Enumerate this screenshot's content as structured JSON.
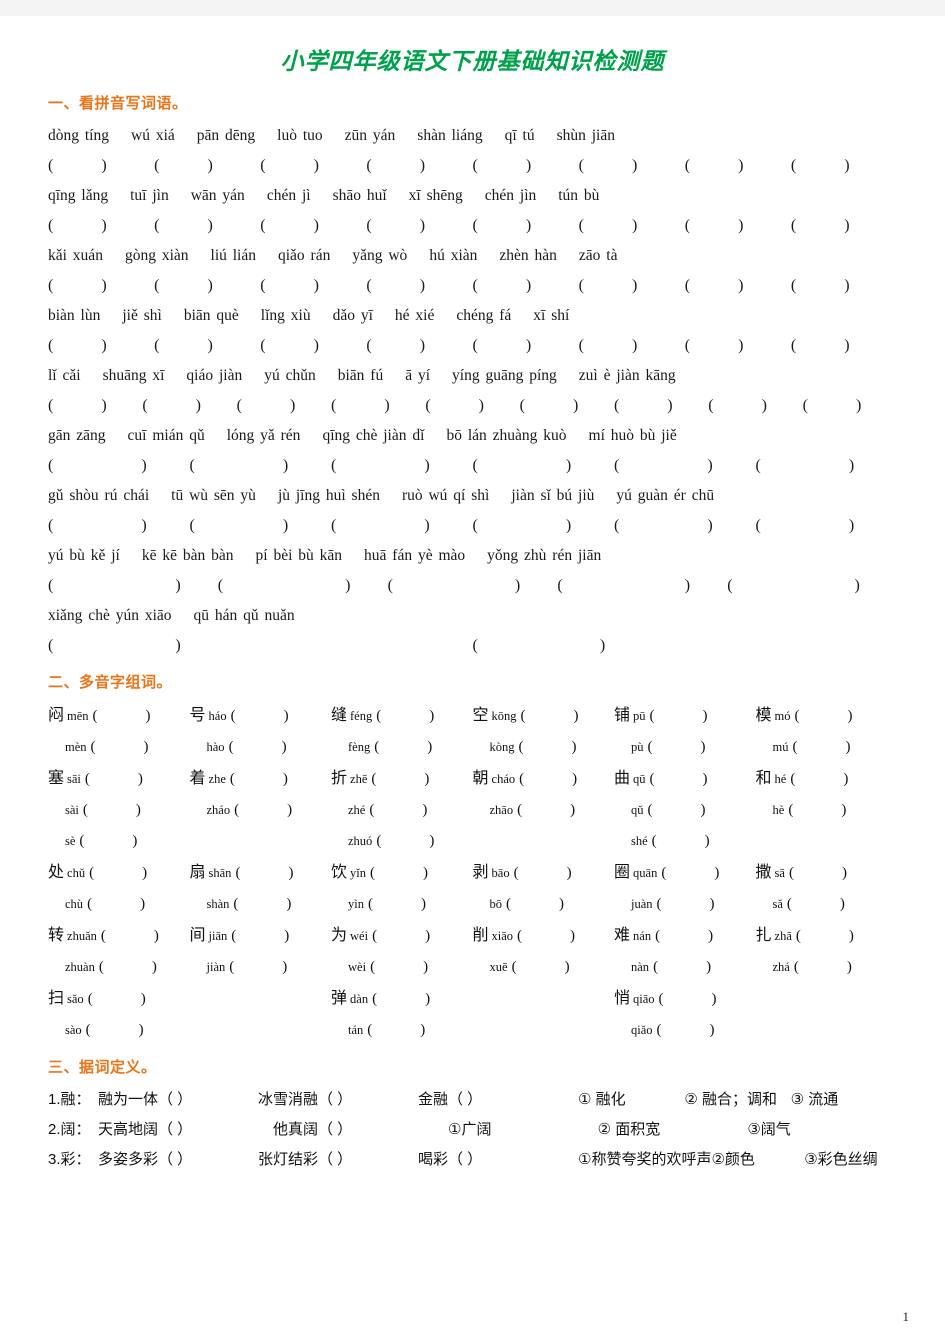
{
  "document": {
    "title": "小学四年级语文下册基础知识检测题",
    "page_number": "1",
    "title_color": "#00A14B",
    "heading_color": "#E8751A"
  },
  "section1": {
    "heading": "一、看拼音写词语。",
    "blocks": [
      {
        "words": [
          "dòng tíng",
          "wú xiá",
          "pān dēng",
          "luò tuo",
          "zūn yán",
          "shàn liáng",
          "qī tú",
          "shùn jiān"
        ],
        "blank_count": 8
      },
      {
        "words": [
          "qīng lǎng",
          "tuī jìn",
          "wān yán",
          "chén jì",
          "shāo huǐ",
          "xī shēng",
          "chén jìn",
          "tún bù"
        ],
        "blank_count": 8
      },
      {
        "words": [
          "kǎi xuán",
          "gòng xiàn",
          "liú lián",
          "qiǎo rán",
          "yǎng wò",
          "hú xiàn",
          "zhèn hàn",
          "zāo tà"
        ],
        "blank_count": 8
      },
      {
        "words": [
          "biàn lùn",
          "jiě shì",
          "biān què",
          "lǐng xiù",
          "dǎo yī",
          "hé xié",
          "chéng fá",
          "xī shí"
        ],
        "blank_count": 8
      },
      {
        "words": [
          "lǐ cǎi",
          "shuāng xī",
          "qiáo jiàn",
          "yú chǔn",
          "biān fú",
          "ā yí",
          "yíng guāng píng",
          "zuì è jiàn kāng"
        ],
        "blank_count": 9
      },
      {
        "words": [
          "gān zāng",
          "cuī mián qǔ",
          "lóng yǎ rén",
          "qīng chè jiàn dǐ",
          "bō lán zhuàng kuò",
          "mí huò bù jiě"
        ],
        "blank_count": 6
      },
      {
        "words": [
          "gǔ shòu rú chái",
          "tū wù sēn yù",
          "jù jīng huì shén",
          "ruò wú qí shì",
          "jiàn sǐ bú jiù",
          "yú guàn ér chū"
        ],
        "blank_count": 6
      },
      {
        "words": [
          "yú bù kě jí",
          "kē kē bàn bàn",
          "pí bèi bù kān",
          "huā fán yè mào",
          "yǒng zhù rén jiān"
        ],
        "blank_count": 5
      },
      {
        "words": [
          "xiǎng chè yún xiāo",
          "qū hán qǔ nuǎn"
        ],
        "blank_count": 2
      }
    ]
  },
  "section2": {
    "heading": "二、多音字组词。",
    "groups": [
      {
        "rows": [
          [
            {
              "han": "闷",
              "py": "mēn"
            },
            {
              "han": "号",
              "py": "háo"
            },
            {
              "han": "缝",
              "py": "féng"
            },
            {
              "han": "空",
              "py": "kōng"
            },
            {
              "han": "铺",
              "py": "pū"
            },
            {
              "han": "模",
              "py": "mó"
            }
          ],
          [
            {
              "han": "",
              "py": "mèn"
            },
            {
              "han": "",
              "py": "hào"
            },
            {
              "han": "",
              "py": "fèng"
            },
            {
              "han": "",
              "py": "kòng"
            },
            {
              "han": "",
              "py": "pù"
            },
            {
              "han": "",
              "py": "mú"
            }
          ]
        ]
      },
      {
        "rows": [
          [
            {
              "han": "塞",
              "py": "sāi"
            },
            {
              "han": "着",
              "py": "zhe"
            },
            {
              "han": "折",
              "py": "zhē"
            },
            {
              "han": "朝",
              "py": "cháo"
            },
            {
              "han": "曲",
              "py": "qū"
            },
            {
              "han": "和",
              "py": "hé"
            }
          ],
          [
            {
              "han": "",
              "py": "sài"
            },
            {
              "han": "",
              "py": "zháo"
            },
            {
              "han": "",
              "py": "zhé"
            },
            {
              "han": "",
              "py": "zhāo"
            },
            {
              "han": "",
              "py": "qǔ"
            },
            {
              "han": "",
              "py": "hè"
            }
          ],
          [
            {
              "han": "",
              "py": "sè"
            },
            {
              "han": "",
              "py": "zhuó"
            },
            {
              "han": "",
              "py": "shé"
            }
          ]
        ]
      },
      {
        "rows": [
          [
            {
              "han": "处",
              "py": "chǔ"
            },
            {
              "han": "扇",
              "py": "shān"
            },
            {
              "han": "饮",
              "py": "yǐn"
            },
            {
              "han": "剥",
              "py": "bāo"
            },
            {
              "han": "圈",
              "py": "quān"
            },
            {
              "han": "撒",
              "py": "sā"
            }
          ],
          [
            {
              "han": "",
              "py": "chù"
            },
            {
              "han": "",
              "py": "shàn"
            },
            {
              "han": "",
              "py": "yìn"
            },
            {
              "han": "",
              "py": "bō"
            },
            {
              "han": "",
              "py": "juàn"
            },
            {
              "han": "",
              "py": "sǎ"
            }
          ]
        ]
      },
      {
        "rows": [
          [
            {
              "han": "转",
              "py": "zhuǎn"
            },
            {
              "han": "间",
              "py": "jiān"
            },
            {
              "han": "为",
              "py": "wéi"
            },
            {
              "han": "削",
              "py": "xiāo"
            },
            {
              "han": "难",
              "py": "nán"
            },
            {
              "han": "扎",
              "py": "zhā"
            }
          ],
          [
            {
              "han": "",
              "py": "zhuàn"
            },
            {
              "han": "",
              "py": "jiàn"
            },
            {
              "han": "",
              "py": "wèi"
            },
            {
              "han": "",
              "py": "xuē"
            },
            {
              "han": "",
              "py": "nàn"
            },
            {
              "han": "",
              "py": "zhá"
            }
          ]
        ]
      },
      {
        "rows": [
          [
            {
              "han": "扫",
              "py": "sǎo"
            },
            {
              "han": "弹",
              "py": "dàn"
            },
            {
              "han": "悄",
              "py": "qiāo"
            }
          ],
          [
            {
              "han": "",
              "py": "sào"
            },
            {
              "han": "",
              "py": "tán"
            },
            {
              "han": "",
              "py": "qiǎo"
            }
          ]
        ]
      }
    ]
  },
  "section3": {
    "heading": "三、据词定义。",
    "rows": [
      {
        "index": "1.融：",
        "items": [
          "融为一体（   ）",
          "冰雪消融（    ）",
          "金融（   ）"
        ],
        "senses": [
          "①  融化",
          "②   融合；调和",
          "③  流通"
        ]
      },
      {
        "index": "2.阔：",
        "items": [
          "天高地阔（   ）",
          "他真阔（    ）"
        ],
        "senses": [
          "①广阔",
          "②  面积宽",
          "③阔气"
        ]
      },
      {
        "index": "3.彩：",
        "items": [
          "多姿多彩（   ）",
          "张灯结彩（    ）",
          "喝彩（   ）"
        ],
        "senses": [
          "①称赞夸奖的欢呼声",
          "②颜色",
          "③彩色丝绸"
        ]
      }
    ]
  }
}
